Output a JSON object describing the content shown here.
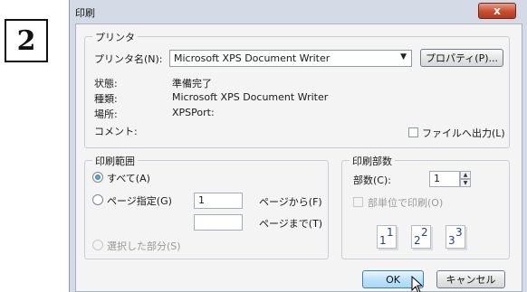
{
  "step": {
    "number": "2"
  },
  "window": {
    "title": "印刷",
    "close_label": "x"
  },
  "printer": {
    "group_title": "プリンタ",
    "name_label": "プリンタ名(N):",
    "name_value": "Microsoft XPS Document Writer",
    "properties_label": "プロパティ(P)...",
    "status_label": "状態:",
    "status_value": "準備完了",
    "type_label": "種類:",
    "type_value": "Microsoft XPS Document Writer",
    "location_label": "場所:",
    "location_value": "XPSPort:",
    "comment_label": "コメント:",
    "print_to_file_label": "ファイルへ出力(L)",
    "print_to_file_checked": false
  },
  "range": {
    "group_title": "印刷範囲",
    "all_label": "すべて(A)",
    "all_selected": true,
    "pages_label": "ページ指定(G)",
    "from_value": "1",
    "from_suffix": "ページから(F)",
    "to_value": "",
    "to_suffix": "ページまで(T)",
    "selection_label": "選択した部分(S)"
  },
  "copies": {
    "group_title": "印刷部数",
    "count_label": "部数(C):",
    "count_value": "1",
    "collate_label": "部単位で印刷(O)",
    "collate_checked": false,
    "illustration": [
      {
        "a": "1",
        "b": "1"
      },
      {
        "a": "2",
        "b": "2"
      },
      {
        "a": "3",
        "b": "3"
      }
    ]
  },
  "buttons": {
    "ok_label": "OK",
    "cancel_label": "キャンセル"
  },
  "colors": {
    "accent": "#3c7fb1",
    "close_red": "#c94b2e",
    "frame": "#d4dbe6"
  }
}
